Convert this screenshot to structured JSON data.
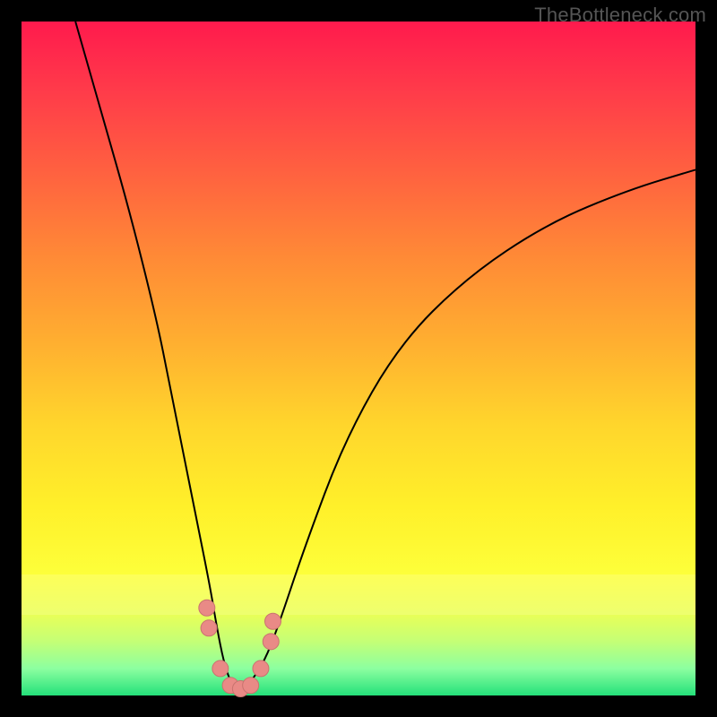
{
  "watermark": "TheBottleneck.com",
  "colors": {
    "top": "#ff1a4d",
    "bottom": "#24e07a",
    "curve": "#000000",
    "marker": "#e98a86",
    "marker_stroke": "#c9736f"
  },
  "chart_data": {
    "type": "line",
    "title": "",
    "xlabel": "",
    "ylabel": "",
    "xlim": [
      0,
      100
    ],
    "ylim": [
      0,
      100
    ],
    "grid": false,
    "legend": false,
    "series": [
      {
        "name": "curve",
        "x": [
          8,
          12,
          16,
          20,
          22,
          24,
          26,
          28,
          29,
          30,
          31,
          32,
          33,
          34,
          36,
          38,
          42,
          48,
          56,
          66,
          78,
          90,
          100
        ],
        "y": [
          100,
          86,
          72,
          56,
          46,
          36,
          26,
          16,
          10,
          5,
          2,
          1,
          1,
          2,
          5,
          10,
          22,
          38,
          52,
          62,
          70,
          75,
          78
        ]
      }
    ],
    "markers": [
      {
        "x": 27.5,
        "y": 13
      },
      {
        "x": 27.8,
        "y": 10
      },
      {
        "x": 29.5,
        "y": 4
      },
      {
        "x": 31.0,
        "y": 1.5
      },
      {
        "x": 32.5,
        "y": 1.0
      },
      {
        "x": 34.0,
        "y": 1.5
      },
      {
        "x": 35.5,
        "y": 4
      },
      {
        "x": 37.0,
        "y": 8
      },
      {
        "x": 37.3,
        "y": 11
      }
    ],
    "highlight_band_y": [
      12,
      18
    ]
  }
}
